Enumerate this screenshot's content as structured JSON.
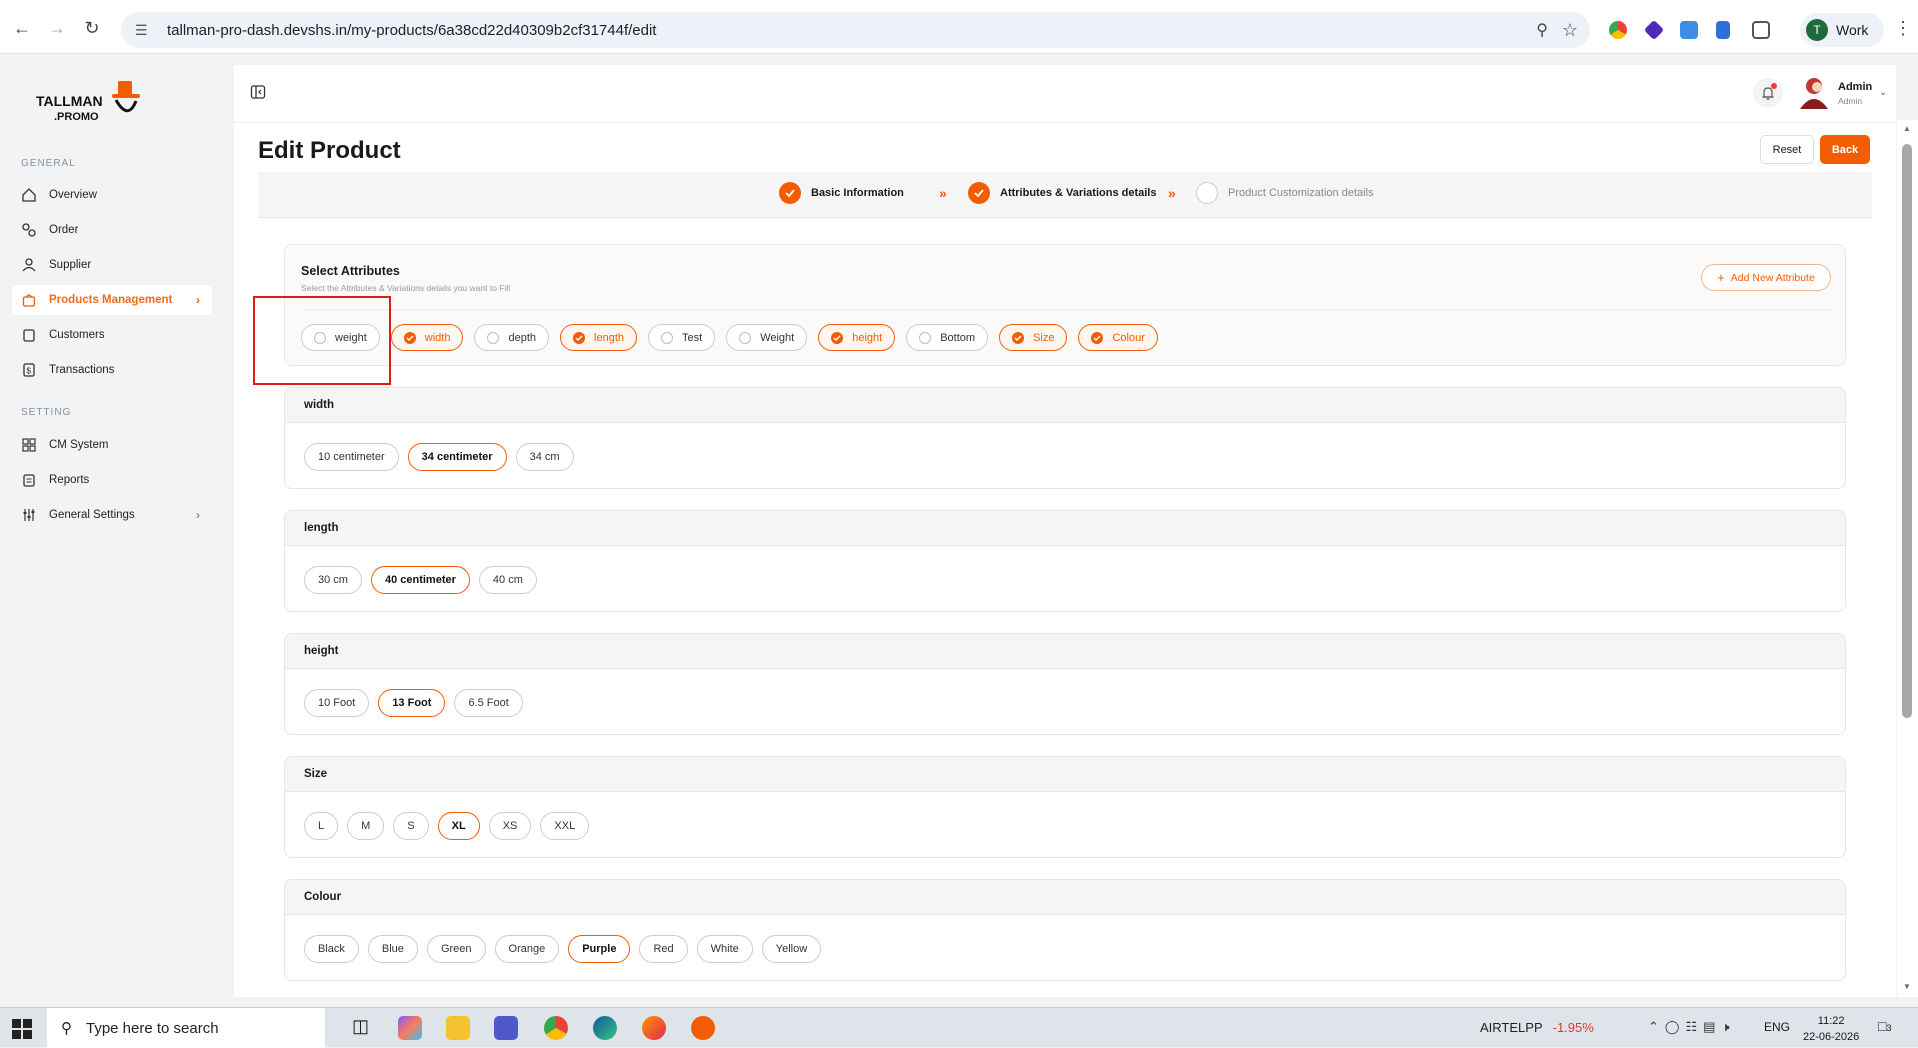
{
  "browser": {
    "url": "tallman-pro-dash.devshs.in/my-products/6a38cd22d40309b2cf31744f/edit",
    "profile_initial": "T",
    "profile_label": "Work"
  },
  "sidebar": {
    "logo_text_top": "TALLMAN",
    "logo_text_bottom": ".PROMO",
    "sections": [
      {
        "label": "GENERAL"
      },
      {
        "label": "SETTING"
      }
    ],
    "items": [
      {
        "label": "Overview",
        "icon": "home-icon"
      },
      {
        "label": "Order",
        "icon": "order-icon"
      },
      {
        "label": "Supplier",
        "icon": "user-icon"
      },
      {
        "label": "Products Management",
        "icon": "bag-icon",
        "active": true
      },
      {
        "label": "Customers",
        "icon": "clipboard-icon"
      },
      {
        "label": "Transactions",
        "icon": "dollar-doc-icon"
      },
      {
        "label": "CM System",
        "icon": "grid-icon"
      },
      {
        "label": "Reports",
        "icon": "report-icon"
      },
      {
        "label": "General Settings",
        "icon": "sliders-icon"
      }
    ]
  },
  "header": {
    "admin_name": "Admin",
    "admin_role": "Admin"
  },
  "page": {
    "title": "Edit Product",
    "reset_label": "Reset",
    "back_label": "Back"
  },
  "stepper": {
    "steps": [
      {
        "label": "Basic Information",
        "state": "done"
      },
      {
        "label": "Attributes & Variations details",
        "state": "done"
      },
      {
        "label": "Product Customization details",
        "state": "pending"
      }
    ]
  },
  "attributes": {
    "title": "Select Attributes",
    "subtitle": "Select the Attributes & Variations details you want to Fill",
    "add_label": "Add New Attribute",
    "chips": [
      {
        "label": "weight",
        "checked": false
      },
      {
        "label": "width",
        "checked": true
      },
      {
        "label": "depth",
        "checked": false
      },
      {
        "label": "length",
        "checked": true
      },
      {
        "label": "Test",
        "checked": false
      },
      {
        "label": "Weight",
        "checked": false
      },
      {
        "label": "height",
        "checked": true
      },
      {
        "label": "Bottom",
        "checked": false
      },
      {
        "label": "Size",
        "checked": true
      },
      {
        "label": "Colour",
        "checked": true
      }
    ]
  },
  "variations": [
    {
      "name": "width",
      "options": [
        "10 centimeter",
        "34 centimeter",
        "34 cm"
      ],
      "selected": "34 centimeter"
    },
    {
      "name": "length",
      "options": [
        "30 cm",
        "40 centimeter",
        "40 cm"
      ],
      "selected": "40 centimeter"
    },
    {
      "name": "height",
      "options": [
        "10 Foot",
        "13 Foot",
        "6.5 Foot"
      ],
      "selected": "13 Foot"
    },
    {
      "name": "Size",
      "options": [
        "L",
        "M",
        "S",
        "XL",
        "XS",
        "XXL"
      ],
      "selected": "XL"
    },
    {
      "name": "Colour",
      "options": [
        "Black",
        "Blue",
        "Green",
        "Orange",
        "Purple",
        "Red",
        "White",
        "Yellow"
      ],
      "selected": "Purple"
    }
  ],
  "taskbar": {
    "search_placeholder": "Type here to search",
    "stock_name": "AIRTELPP",
    "stock_change": "-1.95%",
    "lang": "ENG",
    "time": "11:22",
    "date": "22-06-2026",
    "notif_count": "3"
  },
  "colors": {
    "accent": "#f25c05",
    "highlight": "#e01b1b"
  }
}
